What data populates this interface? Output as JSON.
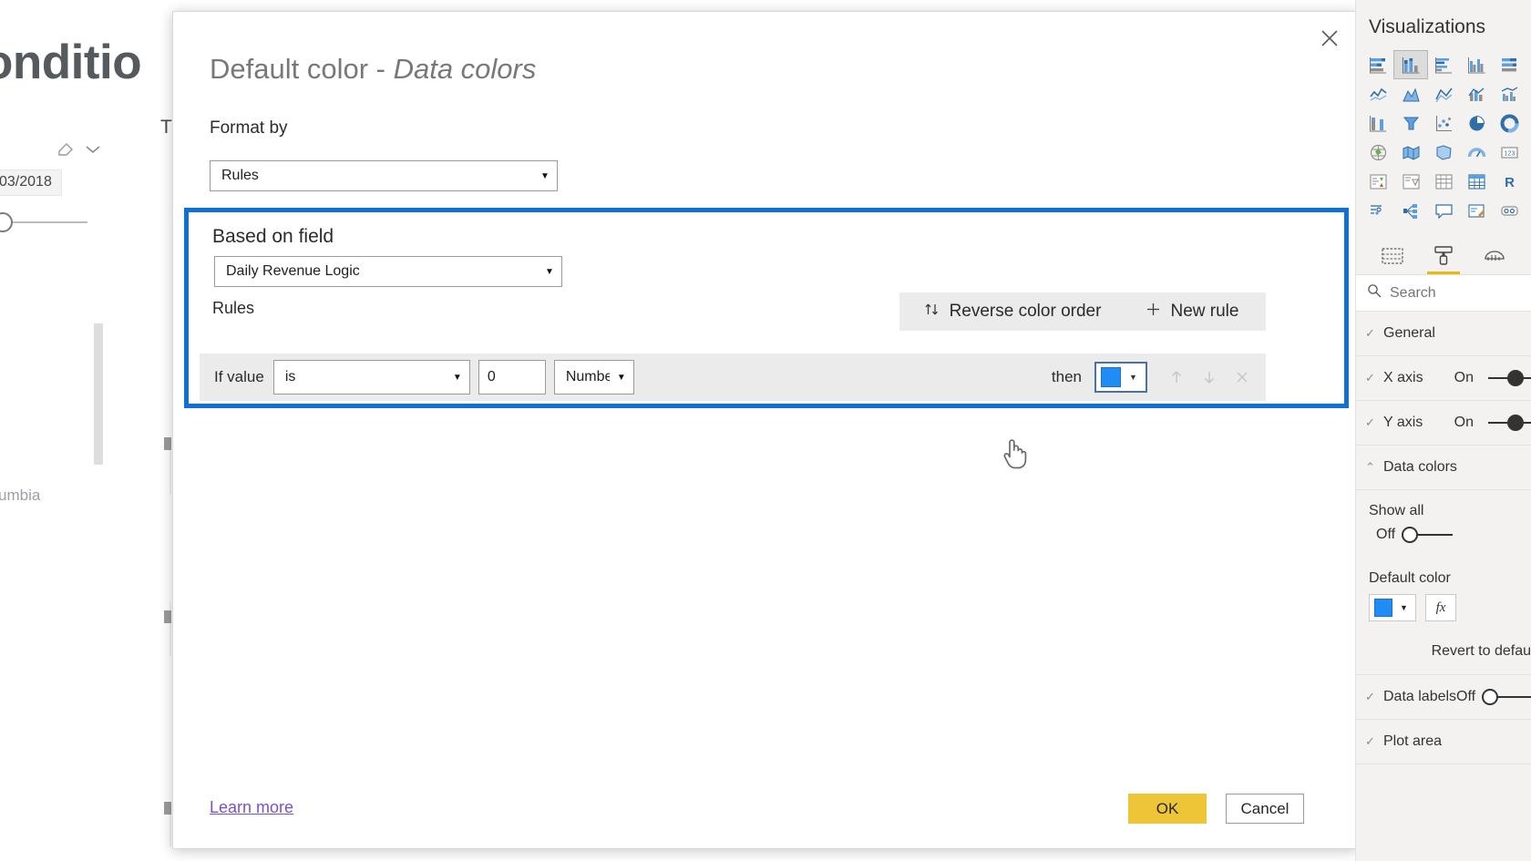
{
  "background": {
    "heading_partial": "onditio",
    "t_letter": "T",
    "date_chip": "03/2018",
    "axis_label_partial": "umbia",
    "eraser_icon": "eraser-icon",
    "chevron_icon": "chevron-down-icon"
  },
  "dialog": {
    "title_main": "Default color - ",
    "title_italic": "Data colors",
    "close_icon": "close-icon",
    "format_by_label": "Format by",
    "format_by_value": "Rules",
    "based_on_field_label": "Based on field",
    "based_on_field_value": "Daily Revenue Logic",
    "rules_label": "Rules",
    "reverse_color_order_label": "Reverse color order",
    "reverse_icon": "sort-updown-icon",
    "new_rule_label": "New rule",
    "new_rule_icon": "plus-icon",
    "rule": {
      "if_value_label": "If value",
      "operator": "is",
      "number_value": "0",
      "value_type": "Number",
      "then_label": "then",
      "color_hex": "#1f8df5",
      "move_up_icon": "arrow-up-icon",
      "move_down_icon": "arrow-down-icon",
      "delete_icon": "close-x-icon"
    },
    "learn_more_label": "Learn more",
    "ok_label": "OK",
    "cancel_label": "Cancel",
    "ok_color": "#eec536",
    "highlight_color": "#1170d4"
  },
  "sidebar": {
    "title": "Visualizations",
    "viz_icons": [
      "stacked-bar-chart-icon",
      "stacked-column-chart-icon",
      "clustered-bar-chart-icon",
      "clustered-column-chart-icon",
      "hundred-percent-stacked-bar-icon",
      "hundred-percent-stacked-column-icon",
      "line-chart-icon",
      "area-chart-icon",
      "stacked-area-chart-icon",
      "line-stacked-column-icon",
      "line-clustered-column-icon",
      "ribbon-chart-icon",
      "waterfall-chart-icon",
      "funnel-chart-icon",
      "scatter-chart-icon",
      "pie-chart-icon",
      "donut-chart-icon",
      "treemap-icon",
      "map-icon",
      "filled-map-icon",
      "gauge-icon",
      "card-icon",
      "multi-row-card-icon",
      "kpi-icon",
      "slicer-icon",
      "table-icon",
      "matrix-icon",
      "r-script-visual-icon",
      "key-influencers-icon",
      "decomposition-tree-icon",
      "qna-visual-icon",
      "smart-narrative-icon",
      "paginated-report-icon"
    ],
    "selected_viz_index": 1,
    "pane_tabs": [
      "fields-pane-icon",
      "format-pane-icon",
      "analytics-pane-icon"
    ],
    "active_pane_tab": 1,
    "search_placeholder": "Search",
    "search_icon": "search-icon",
    "sections": [
      {
        "name": "General",
        "chevron": "chevron-down-icon",
        "toggle": null
      },
      {
        "name": "X axis",
        "chevron": "chevron-down-icon",
        "toggle": "On"
      },
      {
        "name": "Y axis",
        "chevron": "chevron-down-icon",
        "toggle": "On"
      },
      {
        "name": "Data colors",
        "chevron": "chevron-up-icon",
        "toggle": null
      }
    ],
    "data_colors": {
      "show_all_label": "Show all",
      "show_all_state": "Off",
      "default_color_label": "Default color",
      "default_color_hex": "#1f8df5",
      "fx_label": "fx",
      "revert_label": "Revert to defau"
    },
    "sections_bottom": [
      {
        "name": "Data labels",
        "chevron": "chevron-down-icon",
        "toggle": "Off"
      },
      {
        "name": "Plot area",
        "chevron": "chevron-down-icon",
        "toggle": null
      }
    ]
  },
  "cursor": {
    "type": "pointer-hand-cursor"
  }
}
